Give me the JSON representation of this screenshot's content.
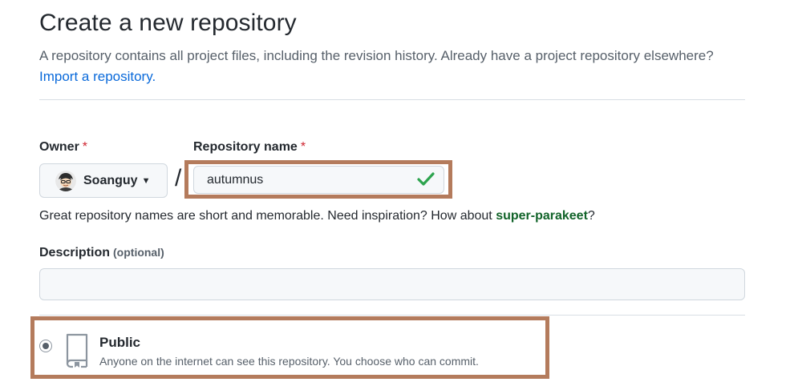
{
  "header": {
    "title": "Create a new repository",
    "subtitle": "A repository contains all project files, including the revision history. Already have a project repository elsewhere?",
    "import_link": "Import a repository."
  },
  "owner": {
    "label": "Owner",
    "required_mark": "*",
    "value": "Soanguy",
    "separator": "/"
  },
  "repository": {
    "label": "Repository name",
    "required_mark": "*",
    "value": "autumnus",
    "valid": true,
    "hint_prefix": "Great repository names are short and memorable. Need inspiration? How about ",
    "suggestion": "super-parakeet",
    "hint_suffix": "?"
  },
  "description": {
    "label": "Description",
    "optional": "(optional)",
    "value": ""
  },
  "visibility": {
    "option_public": {
      "title": "Public",
      "description": "Anyone on the internet can see this repository. You choose who can commit.",
      "selected": true
    }
  },
  "colors": {
    "highlight_border": "#b47b5c",
    "link": "#0969da",
    "suggestion": "#116329",
    "valid_check": "#2da44e",
    "required": "#cf222e"
  },
  "icons": {
    "owner_avatar": "avatar",
    "owner_dropdown": "caret-down-icon",
    "repo_valid": "check-icon",
    "visibility_public": "repo-icon"
  }
}
